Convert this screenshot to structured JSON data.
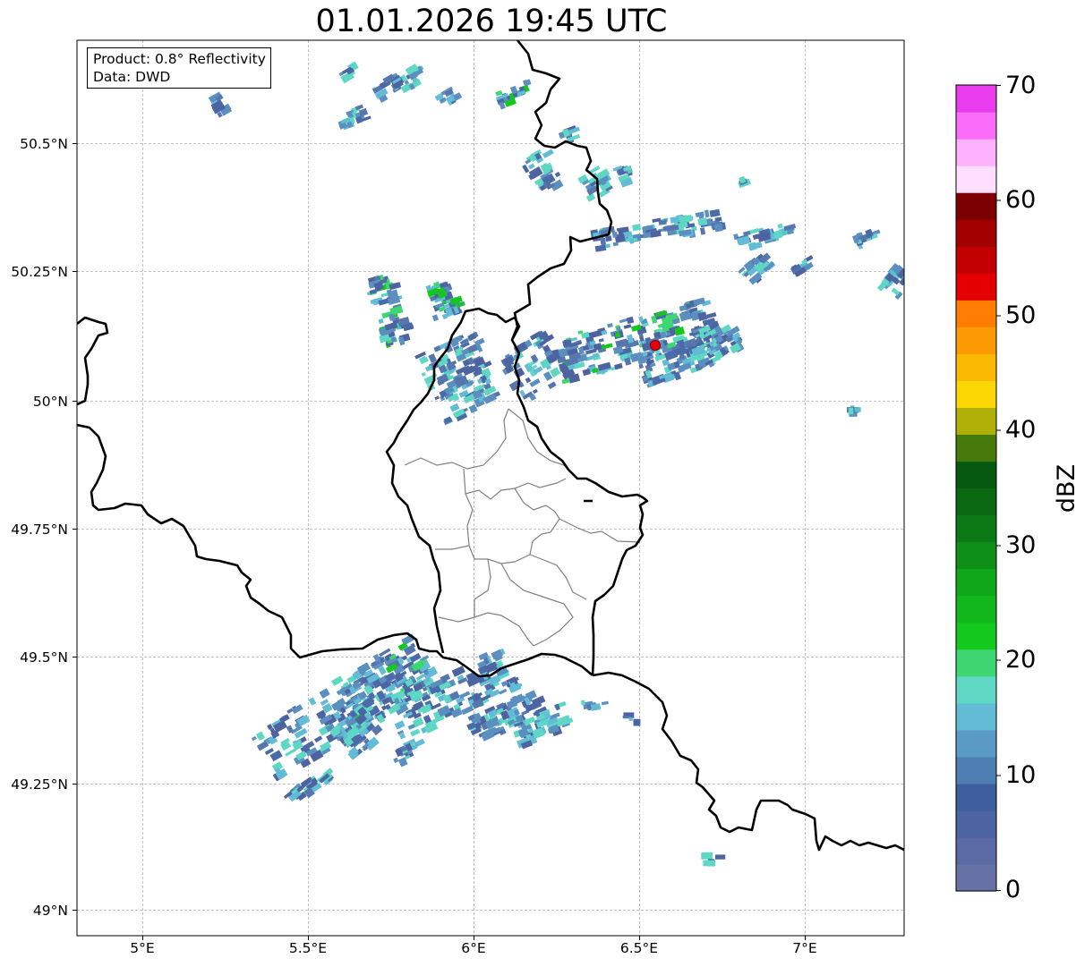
{
  "title": "01.01.2026 19:45 UTC",
  "info": {
    "product": "Product: 0.8° Reflectivity",
    "data": "Data: DWD"
  },
  "map": {
    "lon_range": [
      4.8,
      7.3
    ],
    "lat_range": [
      48.95,
      50.7
    ],
    "gridlines": true,
    "lat_labels": [
      "50.5°N",
      "50.25°N",
      "50°N",
      "49.75°N",
      "49.5°N",
      "49.25°N",
      "49°N"
    ],
    "lon_labels": [
      "5°E",
      "5.5°E",
      "6°E",
      "6.5°E",
      "7°E"
    ],
    "radar_site": {
      "lon": 6.547,
      "lat": 50.11,
      "color": "#e8000b"
    }
  },
  "colorbar": {
    "label": "dBZ",
    "ticks": [
      "70",
      "60",
      "50",
      "40",
      "30",
      "20",
      "10",
      "0"
    ],
    "range": [
      0,
      70
    ],
    "step": 2.5,
    "colors": [
      "#6672a6",
      "#5b6aa3",
      "#4c64a2",
      "#3f5ea0",
      "#4d7fb3",
      "#5a9bc4",
      "#62bcd6",
      "#5ed8c4",
      "#3ed670",
      "#14c91e",
      "#10b81b",
      "#10a71a",
      "#0e8f18",
      "#0b7a16",
      "#0a6813",
      "#065a0f",
      "#457a0a",
      "#aeb007",
      "#fcd603",
      "#fbb903",
      "#fb9a02",
      "#ff7d02",
      "#e40002",
      "#c20002",
      "#a30002",
      "#7c0002",
      "#ffdfff",
      "#fcb2fd",
      "#fa6cf9",
      "#e83cee"
    ]
  }
}
